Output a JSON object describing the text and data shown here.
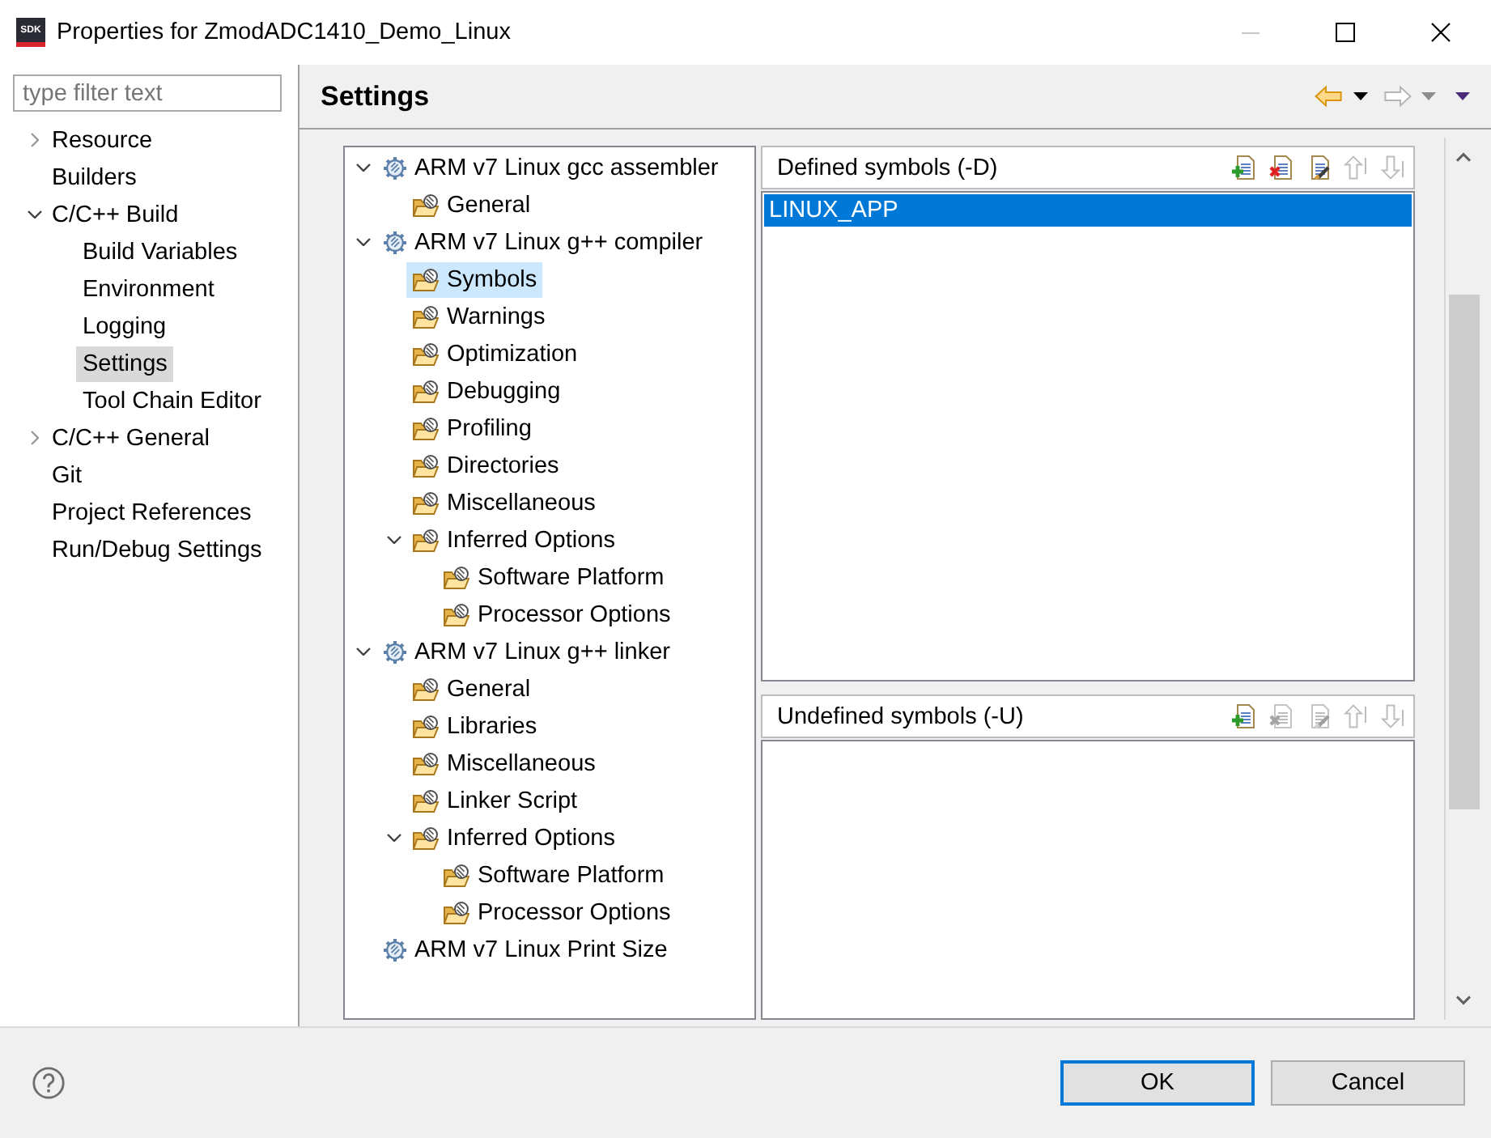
{
  "window": {
    "app_logo": "SDK",
    "title": "Properties for ZmodADC1410_Demo_Linux",
    "controls": [
      {
        "kind": "minimize",
        "disabled": true
      },
      {
        "kind": "maximize",
        "disabled": false
      },
      {
        "kind": "close",
        "disabled": false
      }
    ]
  },
  "sidebar": {
    "filter": {
      "placeholder": "type filter text"
    },
    "items": [
      {
        "label": "Resource",
        "expanded": false,
        "selected": false
      },
      {
        "label": "Builders",
        "selected": false
      },
      {
        "label": "C/C++ Build",
        "expanded": true,
        "selected": false,
        "children": [
          {
            "label": "Build Variables",
            "selected": false
          },
          {
            "label": "Environment",
            "selected": false
          },
          {
            "label": "Logging",
            "selected": false
          },
          {
            "label": "Settings",
            "selected": true
          },
          {
            "label": "Tool Chain Editor",
            "selected": false
          }
        ]
      },
      {
        "label": "C/C++ General",
        "expanded": false,
        "selected": false
      },
      {
        "label": "Git",
        "selected": false
      },
      {
        "label": "Project References",
        "selected": false
      },
      {
        "label": "Run/Debug Settings",
        "selected": false
      }
    ]
  },
  "page": {
    "title": "Settings",
    "nav_buttons": [
      {
        "kind": "back",
        "disabled": false
      },
      {
        "kind": "back-menu",
        "disabled": false
      },
      {
        "kind": "forward",
        "disabled": true
      },
      {
        "kind": "forward-menu",
        "disabled": true
      },
      {
        "kind": "view-menu",
        "disabled": false
      }
    ]
  },
  "tool_tree": {
    "items": [
      {
        "kind": "tool",
        "label": "ARM v7 Linux gcc assembler",
        "expanded": true,
        "selected": false,
        "children": [
          {
            "kind": "category",
            "label": "General",
            "selected": false
          }
        ]
      },
      {
        "kind": "tool",
        "label": "ARM v7 Linux g++ compiler",
        "expanded": true,
        "selected": false,
        "children": [
          {
            "kind": "category",
            "label": "Symbols",
            "selected": true
          },
          {
            "kind": "category",
            "label": "Warnings",
            "selected": false
          },
          {
            "kind": "category",
            "label": "Optimization",
            "selected": false
          },
          {
            "kind": "category",
            "label": "Debugging",
            "selected": false
          },
          {
            "kind": "category",
            "label": "Profiling",
            "selected": false
          },
          {
            "kind": "category",
            "label": "Directories",
            "selected": false
          },
          {
            "kind": "category",
            "label": "Miscellaneous",
            "selected": false
          },
          {
            "kind": "category",
            "label": "Inferred Options",
            "expanded": true,
            "selected": false,
            "children": [
              {
                "kind": "category",
                "label": "Software Platform",
                "selected": false
              },
              {
                "kind": "category",
                "label": "Processor Options",
                "selected": false
              }
            ]
          }
        ]
      },
      {
        "kind": "tool",
        "label": "ARM v7 Linux g++ linker",
        "expanded": true,
        "selected": false,
        "children": [
          {
            "kind": "category",
            "label": "General",
            "selected": false
          },
          {
            "kind": "category",
            "label": "Libraries",
            "selected": false
          },
          {
            "kind": "category",
            "label": "Miscellaneous",
            "selected": false
          },
          {
            "kind": "category",
            "label": "Linker Script",
            "selected": false
          },
          {
            "kind": "category",
            "label": "Inferred Options",
            "expanded": true,
            "selected": false,
            "children": [
              {
                "kind": "category",
                "label": "Software Platform",
                "selected": false
              },
              {
                "kind": "category",
                "label": "Processor Options",
                "selected": false
              }
            ]
          }
        ]
      },
      {
        "kind": "tool",
        "label": "ARM v7 Linux Print Size",
        "selected": false
      }
    ]
  },
  "defined_symbols": {
    "title": "Defined symbols (-D)",
    "tools": [
      {
        "kind": "add",
        "disabled": false
      },
      {
        "kind": "delete",
        "disabled": false
      },
      {
        "kind": "edit",
        "disabled": false
      },
      {
        "kind": "move-up",
        "disabled": true
      },
      {
        "kind": "move-down",
        "disabled": true
      }
    ],
    "items": [
      {
        "label": "LINUX_APP",
        "selected": true
      }
    ]
  },
  "undefined_symbols": {
    "title": "Undefined symbols (-U)",
    "tools": [
      {
        "kind": "add",
        "disabled": false
      },
      {
        "kind": "delete",
        "disabled": true
      },
      {
        "kind": "edit",
        "disabled": true
      },
      {
        "kind": "move-up",
        "disabled": true
      },
      {
        "kind": "move-down",
        "disabled": true
      }
    ]
  },
  "buttons": [
    {
      "label": "OK",
      "default": true
    },
    {
      "label": "Cancel",
      "default": false
    }
  ]
}
